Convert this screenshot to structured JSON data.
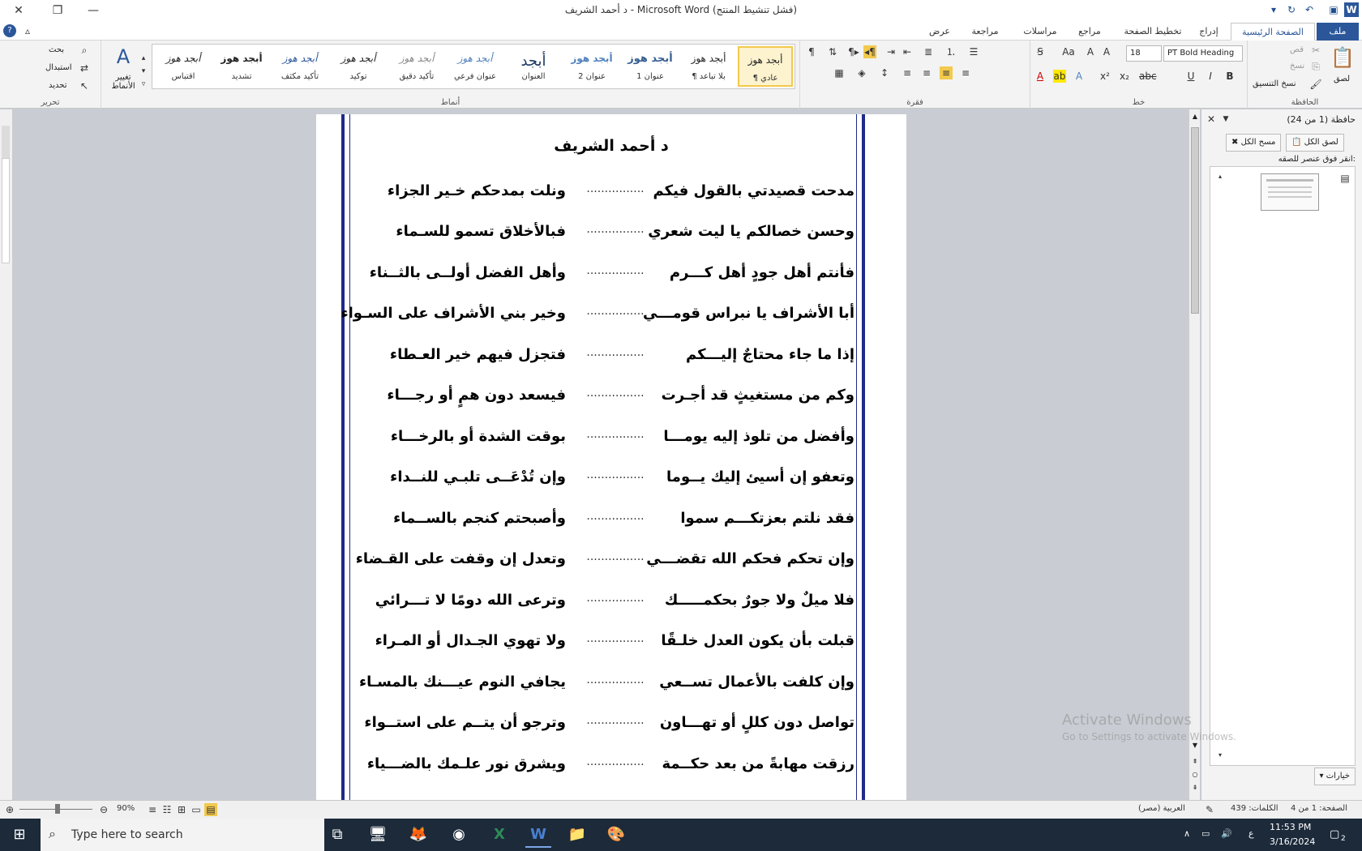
{
  "window": {
    "title": "د أحمد الشريف  -  Microsoft Word (فشل تنشيط المنتج)"
  },
  "tabs": [
    "ملف",
    "الصفحة الرئيسية",
    "إدراج",
    "تخطيط الصفحة",
    "مراجع",
    "مراسلات",
    "مراجعة",
    "عرض"
  ],
  "ribbon": {
    "clipboard": {
      "label": "الحافظة",
      "paste": "لصق",
      "cut": "قص",
      "copy": "نسخ",
      "format_painter": "نسخ التنسيق"
    },
    "font": {
      "label": "خط",
      "font_name": "PT Bold Heading",
      "font_size": "18"
    },
    "paragraph": {
      "label": "فقرة"
    },
    "styles": {
      "label": "أنماط",
      "items": [
        {
          "sample": "أبجد هوز",
          "name": "¶ عادي"
        },
        {
          "sample": "أبجد هوز",
          "name": "¶ بلا تباعد"
        },
        {
          "sample": "أبجد هوز",
          "name": "عنوان 1"
        },
        {
          "sample": "أبجد هوز",
          "name": "عنوان 2"
        },
        {
          "sample": "أبجد",
          "name": "العنوان"
        },
        {
          "sample": "أبجد هوز",
          "name": "عنوان فرعي"
        },
        {
          "sample": "أبجد هوز",
          "name": "تأكيد دقيق"
        },
        {
          "sample": "أبجد هوز",
          "name": "توكيد"
        },
        {
          "sample": "أبجد هوز",
          "name": "تأكيد مكثف"
        },
        {
          "sample": "أبجد هوز",
          "name": "تشديد"
        },
        {
          "sample": "أبجد هوز",
          "name": "اقتباس"
        }
      ],
      "change_styles": "تغيير الأنماط"
    },
    "editing": {
      "label": "تحرير",
      "find": "بحث",
      "replace": "استبدال",
      "select": "تحديد"
    }
  },
  "document": {
    "title": "د أحمد الشريف",
    "dots": "................",
    "verses": [
      {
        "first": "مدحت قصيدتي بالقول فيكم",
        "second": "ونلت بمدحكم  خـير الجزاء"
      },
      {
        "first": "وحسن خصالكم يا ليت شعري",
        "second": "فبالأخلاق تسمو للسـماء"
      },
      {
        "first": "فأنتم أهل جودٍ أهل كـــرم",
        "second": "وأهل الفضل أولــى بالثــناء"
      },
      {
        "first": "أبا الأشراف يا نبراس قومـــي",
        "second": "وخير بني الأشراف على السـواء"
      },
      {
        "first": "إذا ما جاء محتاجٌ إليـــكم",
        "second": "فتجزل فيهم خير العـطاء"
      },
      {
        "first": "وكم من مستغيثٍ قد أجـرت",
        "second": "فيسعد دون همٍ أو رجـــاء"
      },
      {
        "first": "وأفضل من تلوذ إليه يومـــا",
        "second": "بوقت الشدة أو بالرخـــاء"
      },
      {
        "first": "وتعفو إن أسيئ إليك يــوما",
        "second": "وإن تُدْعَــى تلبـي للنــداء"
      },
      {
        "first": "فقد نلتم بعزتكـــم سموا",
        "second": "وأصبحتم كنجم بالســماء"
      },
      {
        "first": "وإن تحكم فحكم الله تقضـــي",
        "second": "وتعدل إن وقفت على القـضاء"
      },
      {
        "first": "فلا ميلٌ ولا جورٌ بحكمـــــك",
        "second": "وترعى الله دومًا لا تـــرائي"
      },
      {
        "first": "قبلت بأن يكون العدل خلـقًا",
        "second": "ولا تهوي الجـدال أو المـراء"
      },
      {
        "first": "وإن كلفت بالأعمال تســعي",
        "second": "يجافي النوم عيـــنك بالمسـاء"
      },
      {
        "first": "تواصل دون كللٍ أو تهـــاون",
        "second": "وترجو أن يتــم على استــواء"
      },
      {
        "first": "رزقت مهابةً  من بعد حكــمة",
        "second": "ويشرق نور علـمك بالضـــياء"
      }
    ]
  },
  "clipboard_pane": {
    "title": "حافظة (1 من 24)",
    "paste_all": "لصق الكل",
    "clear_all": "مسح الكل",
    "hint": "انقر فوق عنصر للصقه:",
    "options": "خيارات"
  },
  "activation": {
    "title": "Activate Windows",
    "subtitle": "Go to Settings to activate Windows."
  },
  "statusbar": {
    "page": "الصفحة: 1 من 4",
    "words": "الكلمات: 439",
    "language": "العربية (مصر)",
    "zoom": "90%"
  },
  "taskbar": {
    "search_placeholder": "Type here to search",
    "time": "11:53 PM",
    "date": "3/16/2024",
    "lang": "ع",
    "notifications": "2"
  }
}
